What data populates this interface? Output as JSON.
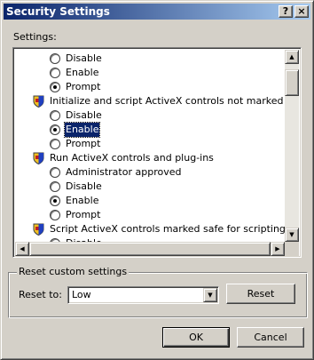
{
  "window": {
    "title": "Security Settings",
    "help_glyph": "?",
    "close_glyph": "×"
  },
  "settings_label": "Settings:",
  "list": {
    "items": [
      {
        "kind": "option",
        "label": "Disable",
        "checked": false
      },
      {
        "kind": "option",
        "label": "Enable",
        "checked": false
      },
      {
        "kind": "option",
        "label": "Prompt",
        "checked": true
      },
      {
        "kind": "header",
        "label": "Initialize and script ActiveX controls not marked as safe"
      },
      {
        "kind": "option",
        "label": "Disable",
        "checked": false
      },
      {
        "kind": "option",
        "label": "Enable",
        "checked": true,
        "focused": true
      },
      {
        "kind": "option",
        "label": "Prompt",
        "checked": false
      },
      {
        "kind": "header",
        "label": "Run ActiveX controls and plug-ins"
      },
      {
        "kind": "option",
        "label": "Administrator approved",
        "checked": false
      },
      {
        "kind": "option",
        "label": "Disable",
        "checked": false
      },
      {
        "kind": "option",
        "label": "Enable",
        "checked": true
      },
      {
        "kind": "option",
        "label": "Prompt",
        "checked": false
      },
      {
        "kind": "header",
        "label": "Script ActiveX controls marked safe for scripting"
      },
      {
        "kind": "option",
        "label": "Disable",
        "checked": false
      }
    ],
    "scroll_up_glyph": "▲",
    "scroll_down_glyph": "▼",
    "scroll_left_glyph": "◀",
    "scroll_right_glyph": "▶"
  },
  "reset_group": {
    "title": "Reset custom settings",
    "reset_to_label": "Reset to:",
    "reset_to_value": "Low",
    "dropdown_glyph": "▼",
    "reset_button": "Reset"
  },
  "buttons": {
    "ok": "OK",
    "cancel": "Cancel"
  },
  "colors": {
    "title_start": "#0a246a",
    "title_end": "#a6caf0",
    "face": "#d4d0c8",
    "selection": "#0a246a"
  }
}
